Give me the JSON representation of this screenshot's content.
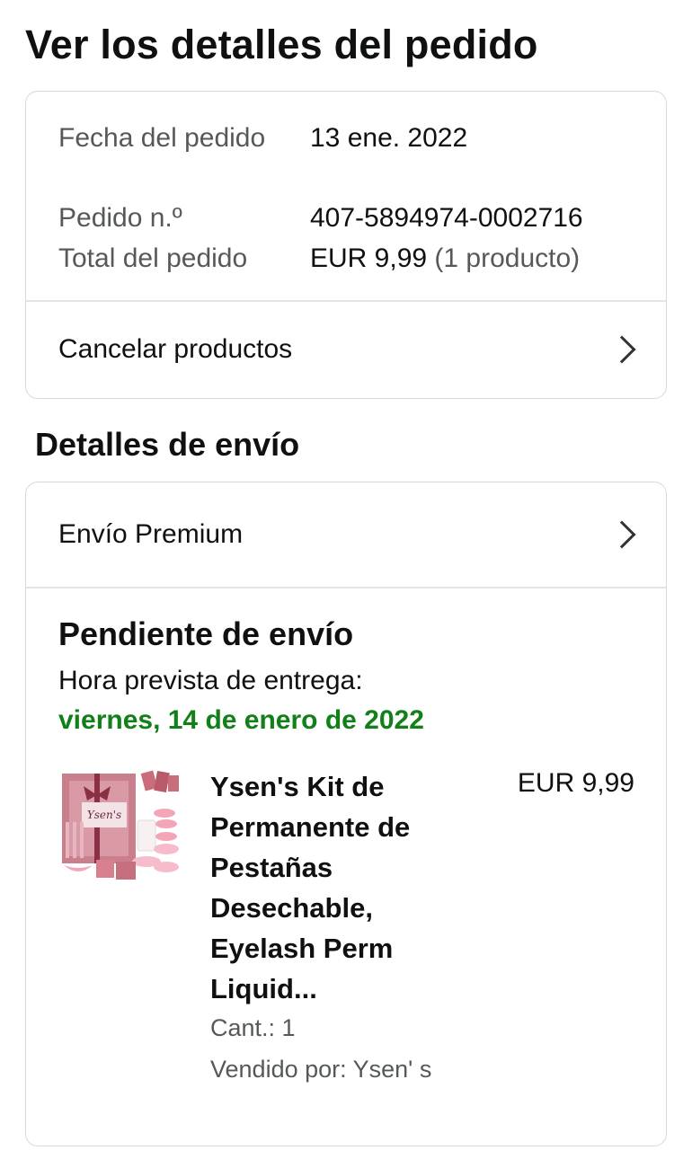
{
  "page": {
    "title": "Ver los detalles del pedido"
  },
  "summary": {
    "date_label": "Fecha del pedido",
    "date_value": "13 ene. 2022",
    "order_label": "Pedido n.º",
    "order_value": "407-5894974-0002716",
    "total_label": "Total del pedido",
    "total_value": "EUR 9,99",
    "total_count": "(1 producto)",
    "cancel_label": "Cancelar productos"
  },
  "shipping": {
    "heading": "Detalles de envío",
    "method": "Envío Premium",
    "status": "Pendiente de envío",
    "eta_label": "Hora prevista de entrega:",
    "eta_date": "viernes, 14 de enero de 2022",
    "eta_color": "#118019"
  },
  "product": {
    "title": "Ysen's Kit de Permanente de Pestañas Desechable, Eyelash Perm Liquid...",
    "price": "EUR 9,99",
    "qty": "Cant.: 1",
    "seller": "Vendido por: Ysen' s",
    "image_box_text": "Ysen's"
  },
  "icons": {
    "chevron": "chevron-right-icon"
  }
}
